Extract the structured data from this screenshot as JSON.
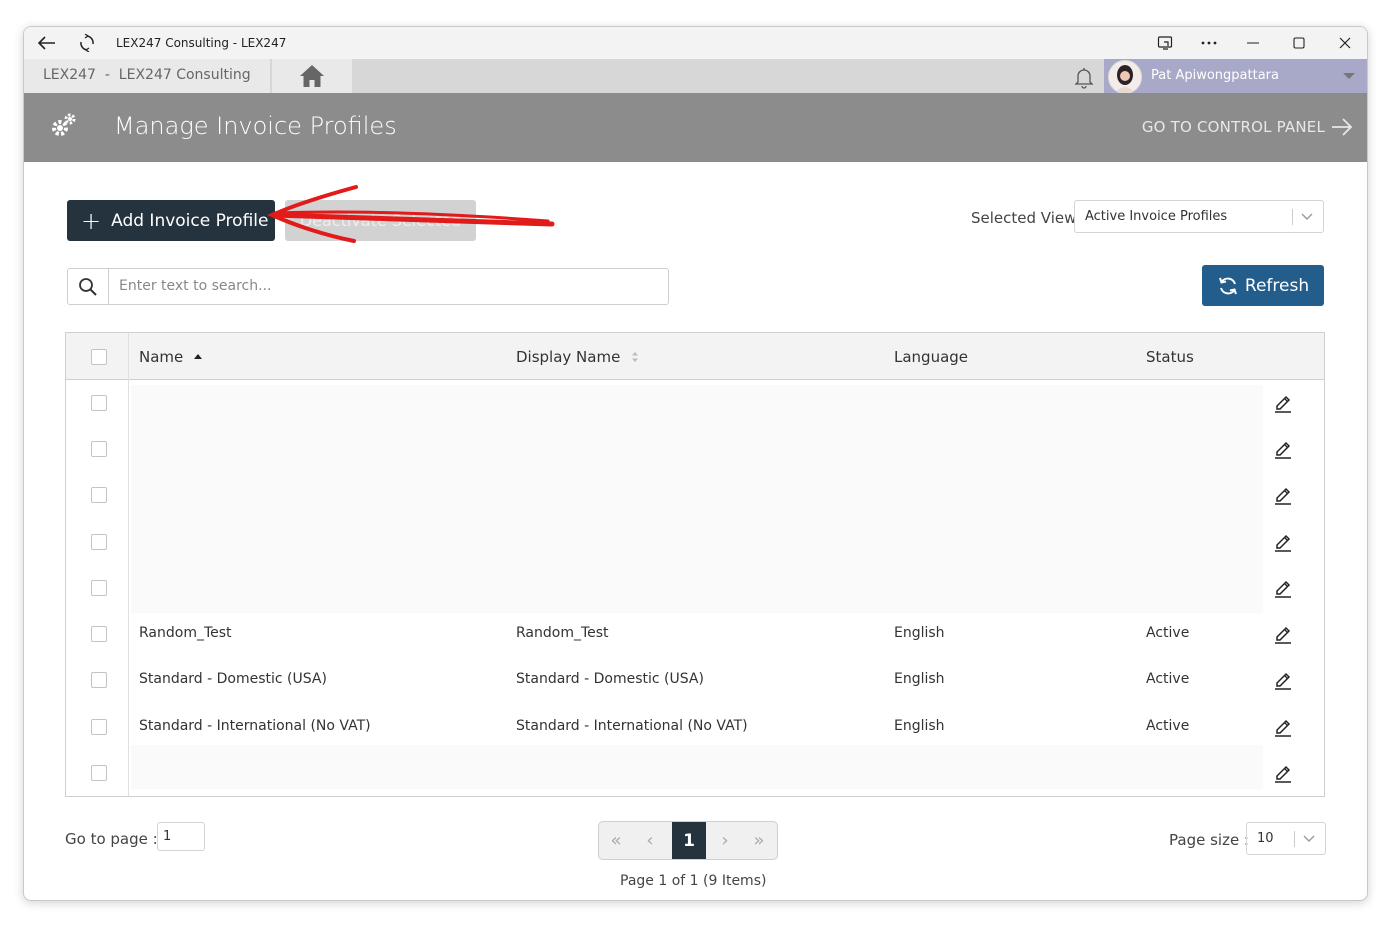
{
  "window": {
    "title": "LEX247 Consulting - LEX247"
  },
  "appbar": {
    "tenant": "LEX247  -  LEX247 Consulting",
    "user_name": "Pat Apiwongpattara"
  },
  "header": {
    "title": "Manage Invoice Profiles",
    "goto_label": "GO TO CONTROL PANEL"
  },
  "toolbar": {
    "add_label": "Add Invoice Profile",
    "deactivate_label": "Deactivate Selected",
    "selected_view_label": "Selected View",
    "selected_view_value": "Active Invoice Profiles",
    "search_placeholder": "Enter text to search...",
    "refresh_label": "Refresh"
  },
  "grid": {
    "columns": [
      "Name",
      "Display Name",
      "Language",
      "Status"
    ],
    "rows": [
      {
        "name": "",
        "display_name": "",
        "language": "",
        "status": ""
      },
      {
        "name": "",
        "display_name": "",
        "language": "",
        "status": ""
      },
      {
        "name": "",
        "display_name": "",
        "language": "",
        "status": ""
      },
      {
        "name": "",
        "display_name": "",
        "language": "",
        "status": ""
      },
      {
        "name": "",
        "display_name": "",
        "language": "",
        "status": ""
      },
      {
        "name": "Random_Test",
        "display_name": "Random_Test",
        "language": "English",
        "status": "Active"
      },
      {
        "name": "Standard - Domestic (USA)",
        "display_name": "Standard - Domestic (USA)",
        "language": "English",
        "status": "Active"
      },
      {
        "name": "Standard - International (No VAT)",
        "display_name": "Standard - International (No VAT)",
        "language": "English",
        "status": "Active"
      },
      {
        "name": "",
        "display_name": "",
        "language": "",
        "status": ""
      }
    ]
  },
  "pagination": {
    "goto_label": "Go to page :",
    "goto_value": "1",
    "current_page": "1",
    "info": "Page 1 of 1 (9 Items)",
    "page_size_label": "Page size :",
    "page_size_value": "10"
  },
  "colors": {
    "header_bg": "#8c8c8c",
    "primary_dark": "#25333f",
    "refresh_blue": "#225d8b",
    "user_bar": "#a8a9c9",
    "annotation_red": "#e11a1a"
  }
}
